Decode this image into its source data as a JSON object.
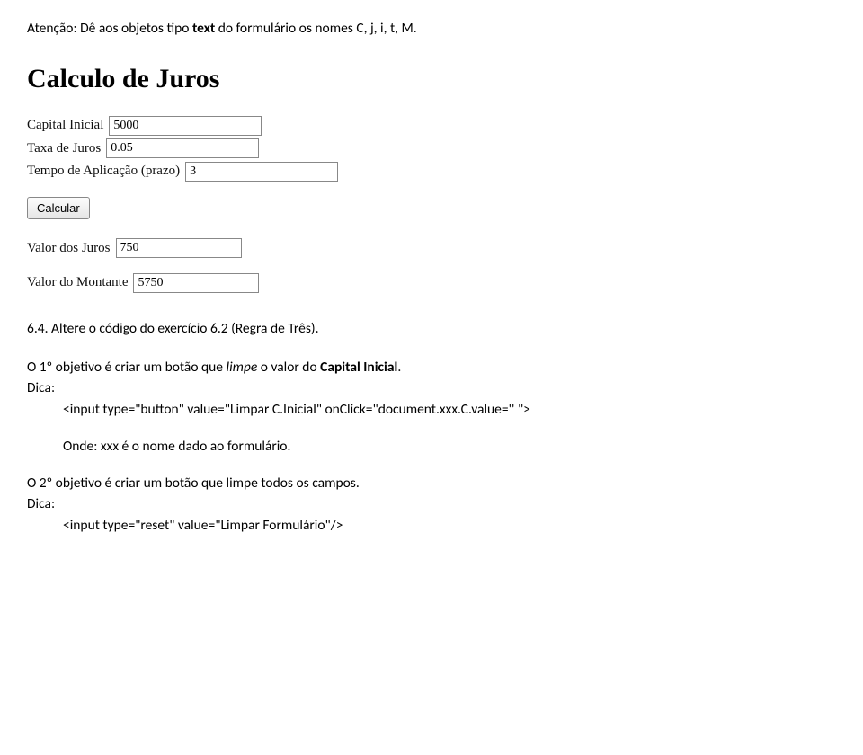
{
  "intro": {
    "prefix": "Atenção: Dê aos objetos tipo ",
    "bold1": "text",
    "rest": " do formulário os nomes C, j, i, t, M."
  },
  "form": {
    "title": "Calculo de Juros",
    "capital_label": "Capital Inicial",
    "capital_value": "5000",
    "taxa_label": "Taxa de Juros",
    "taxa_value": "0.05",
    "tempo_label": "Tempo de Aplicação (prazo)",
    "tempo_value": "3",
    "calcular_label": "Calcular",
    "juros_label": "Valor dos Juros",
    "juros_value": "750",
    "montante_label": "Valor do Montante",
    "montante_value": "5750"
  },
  "section64": {
    "heading": "6.4. Altere o código do exercício 6.2 (Regra de Três).",
    "obj1_prefix": "O 1º objetivo é criar um botão que ",
    "obj1_italic": "limpe",
    "obj1_mid": " o valor do ",
    "obj1_bold": "Capital Inicial",
    "obj1_suffix": ".",
    "dica": "Dica:",
    "code1": "<input type=\"button\" value=\"Limpar C.Inicial\" onClick=\"document.xxx.C.value='' \">",
    "onde": "Onde: xxx é o nome dado ao formulário.",
    "obj2": "O 2º objetivo é criar um botão que limpe todos os campos.",
    "code2": "<input type=\"reset\" value=\"Limpar Formulário\"/>"
  }
}
